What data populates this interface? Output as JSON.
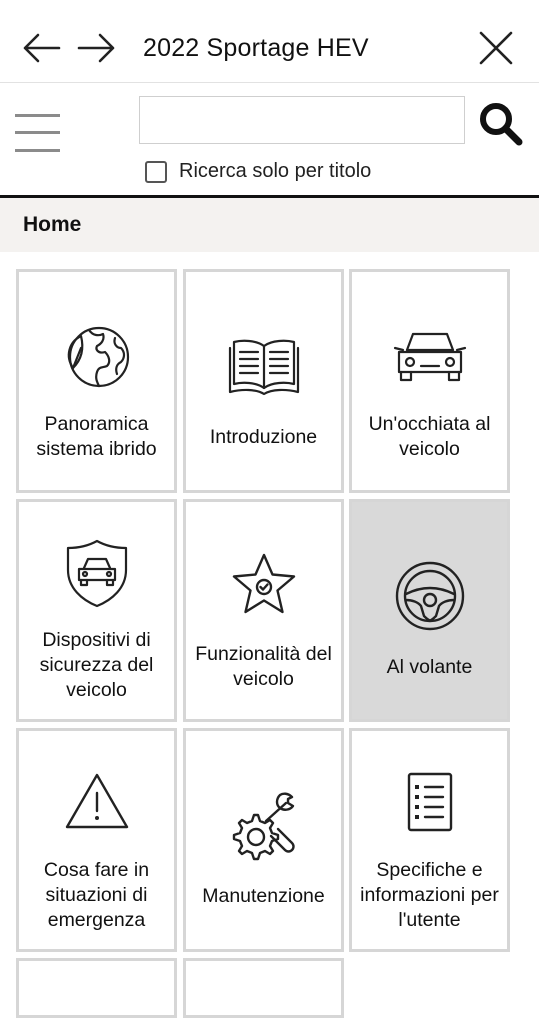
{
  "header": {
    "back_icon": "arrow-left-icon",
    "forward_icon": "arrow-right-icon",
    "title": "2022 Sportage HEV",
    "close_icon": "close-icon"
  },
  "search": {
    "menu_icon": "hamburger-menu-icon",
    "value": "",
    "placeholder": "",
    "search_icon": "search-icon",
    "title_only_label": "Ricerca solo per titolo",
    "title_only_checked": false
  },
  "breadcrumb": {
    "home": "Home"
  },
  "tiles": [
    {
      "label": "Panoramica sistema ibrido",
      "icon": "globe-leaf-icon"
    },
    {
      "label": "Introduzione",
      "icon": "open-book-icon"
    },
    {
      "label": "Un'occhiata al veicolo",
      "icon": "car-front-icon"
    },
    {
      "label": "Dispositivi di sicurezza del veicolo",
      "icon": "shield-car-icon"
    },
    {
      "label": "Funzionalità del veicolo",
      "icon": "star-check-icon"
    },
    {
      "label": "Al volante",
      "icon": "steering-wheel-icon",
      "selected": true
    },
    {
      "label": "Cosa fare in situazioni di emergenza",
      "icon": "warning-triangle-icon"
    },
    {
      "label": "Manutenzione",
      "icon": "gear-wrench-icon"
    },
    {
      "label": "Specifiche e informazioni per l'utente",
      "icon": "checklist-icon"
    }
  ],
  "colors": {
    "tile_border": "#d6d6d6",
    "tile_selected_bg": "#d9d9d9",
    "breadcrumb_bg": "#f4f2f0"
  }
}
